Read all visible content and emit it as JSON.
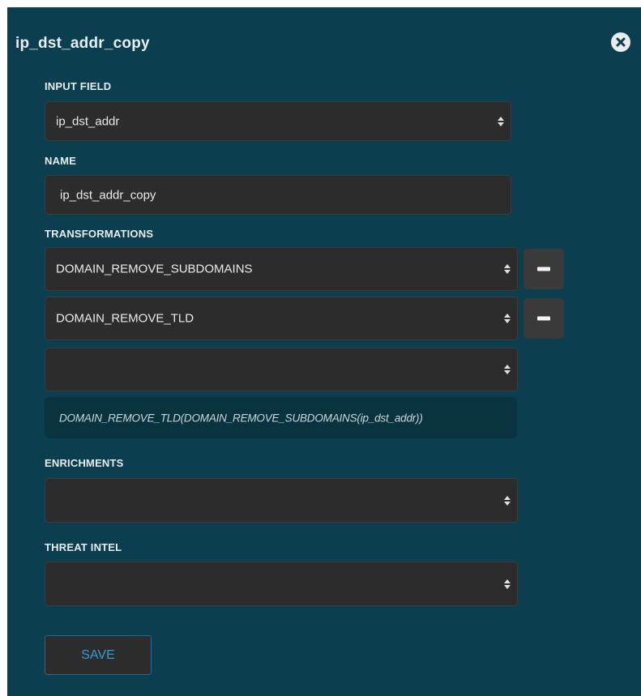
{
  "panel": {
    "title": "ip_dst_addr_copy"
  },
  "input_field": {
    "label": "INPUT FIELD",
    "value": "ip_dst_addr"
  },
  "name_field": {
    "label": "NAME",
    "value": "ip_dst_addr_copy"
  },
  "transformations": {
    "label": "TRANSFORMATIONS",
    "items": [
      {
        "value": "DOMAIN_REMOVE_SUBDOMAINS"
      },
      {
        "value": "DOMAIN_REMOVE_TLD"
      },
      {
        "value": ""
      }
    ],
    "expression": "DOMAIN_REMOVE_TLD(DOMAIN_REMOVE_SUBDOMAINS(ip_dst_addr))"
  },
  "enrichments": {
    "label": "ENRICHMENTS",
    "value": ""
  },
  "threat_intel": {
    "label": "THREAT INTEL",
    "value": ""
  },
  "actions": {
    "save_label": "SAVE"
  },
  "icons": {
    "close": "close-circle-icon",
    "select_caret": "sort-caret-icon",
    "remove": "minus-icon"
  },
  "colors": {
    "panel_bg": "#0b3f50",
    "field_bg": "#2c2c2c",
    "accent": "#2f9ed8"
  }
}
